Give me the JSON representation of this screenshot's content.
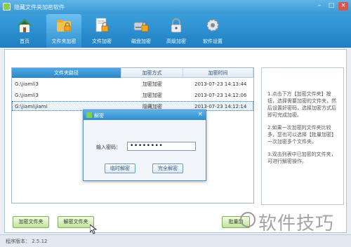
{
  "window": {
    "title": "隐藏文件夹加密软件",
    "controls": {
      "minimize": "–",
      "maximize": "□",
      "close": "×"
    }
  },
  "toolbar": {
    "items": [
      {
        "label": "首页",
        "icon": "home-icon"
      },
      {
        "label": "文件夹加密",
        "icon": "folder-lock-icon",
        "active": true
      },
      {
        "label": "文件加密",
        "icon": "file-lock-icon"
      },
      {
        "label": "磁盘加密",
        "icon": "disk-lock-icon"
      },
      {
        "label": "高级加密",
        "icon": "padlock-icon"
      },
      {
        "label": "软件设置",
        "icon": "gear-icon"
      }
    ]
  },
  "file_list": {
    "columns": [
      "文件夹路径",
      "加密方式",
      "加密时间"
    ],
    "rows": [
      {
        "path": "G:\\jiami\\3",
        "method": "加密加密",
        "time": "2013-07-23 14:13:44"
      },
      {
        "path": "G:\\jiami\\3",
        "method": "加密加密",
        "time": "2013-07-23 14:12:06"
      },
      {
        "path": "G:\\jiami\\jiami",
        "method": "隐藏加密",
        "time": "2013-07-23 14:12:14",
        "selected": true
      }
    ]
  },
  "instructions": [
    "1.点击下方【加密文件夹】按钮，选择需要加密的文件夹，然后设置好密码，选择加密方式后即可完成加密。",
    "2.如果一次加密的文件夹比较多，您也可以选择【批量加密】一次加密多个文件夹。",
    "3.双击列表中已加密的文件夹，可进行解密操作。"
  ],
  "dialog": {
    "title": "解密",
    "password_label": "输入密码：",
    "password_value": "••••••••",
    "ok_label": "临时解密",
    "cancel_label": "完全解密"
  },
  "buttons": {
    "encrypt_folder": "加密文件夹",
    "decrypt_folder": "解密文件夹",
    "batch_encrypt": "批量加"
  },
  "status": {
    "version_label": "程序版本：",
    "version_value": "2.5.12"
  },
  "watermark": {
    "text": "软件技巧"
  },
  "colors": {
    "title_bar": "#3b98d4",
    "toolbar": "#1f7fc2",
    "green_button": "#bfe29b"
  }
}
